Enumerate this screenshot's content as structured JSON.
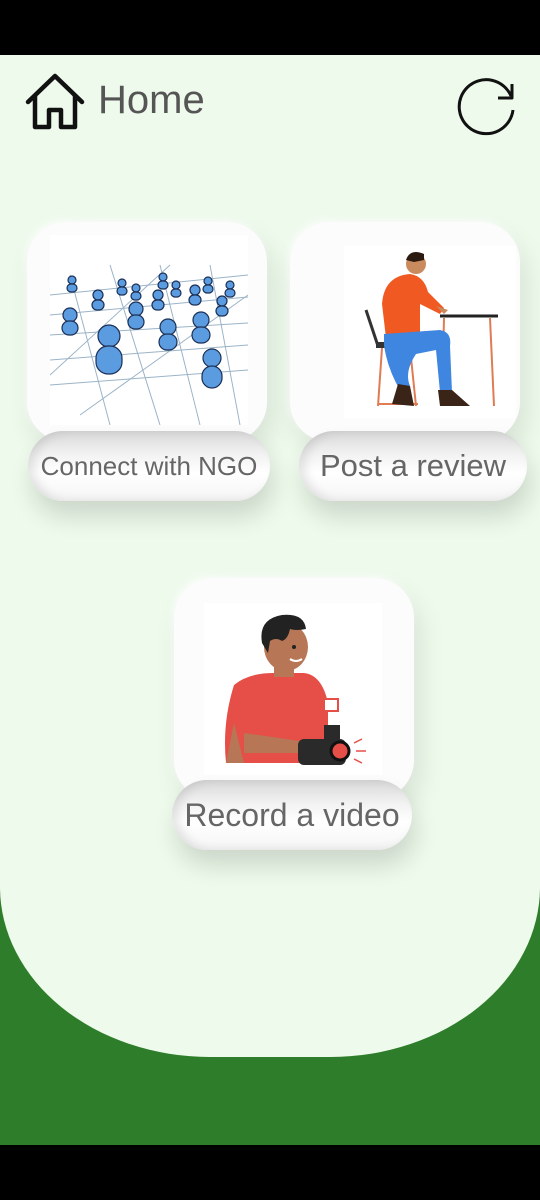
{
  "header": {
    "title": "Home",
    "home_icon": "home-outline-icon",
    "refresh_icon": "refresh-icon"
  },
  "cards": [
    {
      "label": "Connect with NGO",
      "illustration": "people-network-illustration"
    },
    {
      "label": "Post a review",
      "illustration": "person-at-desk-illustration"
    },
    {
      "label": "Record a video",
      "illustration": "man-with-camera-illustration"
    }
  ],
  "colors": {
    "panel_bg": "#eefbec",
    "bottom_bg": "#2e7d2a",
    "text": "#555555"
  }
}
